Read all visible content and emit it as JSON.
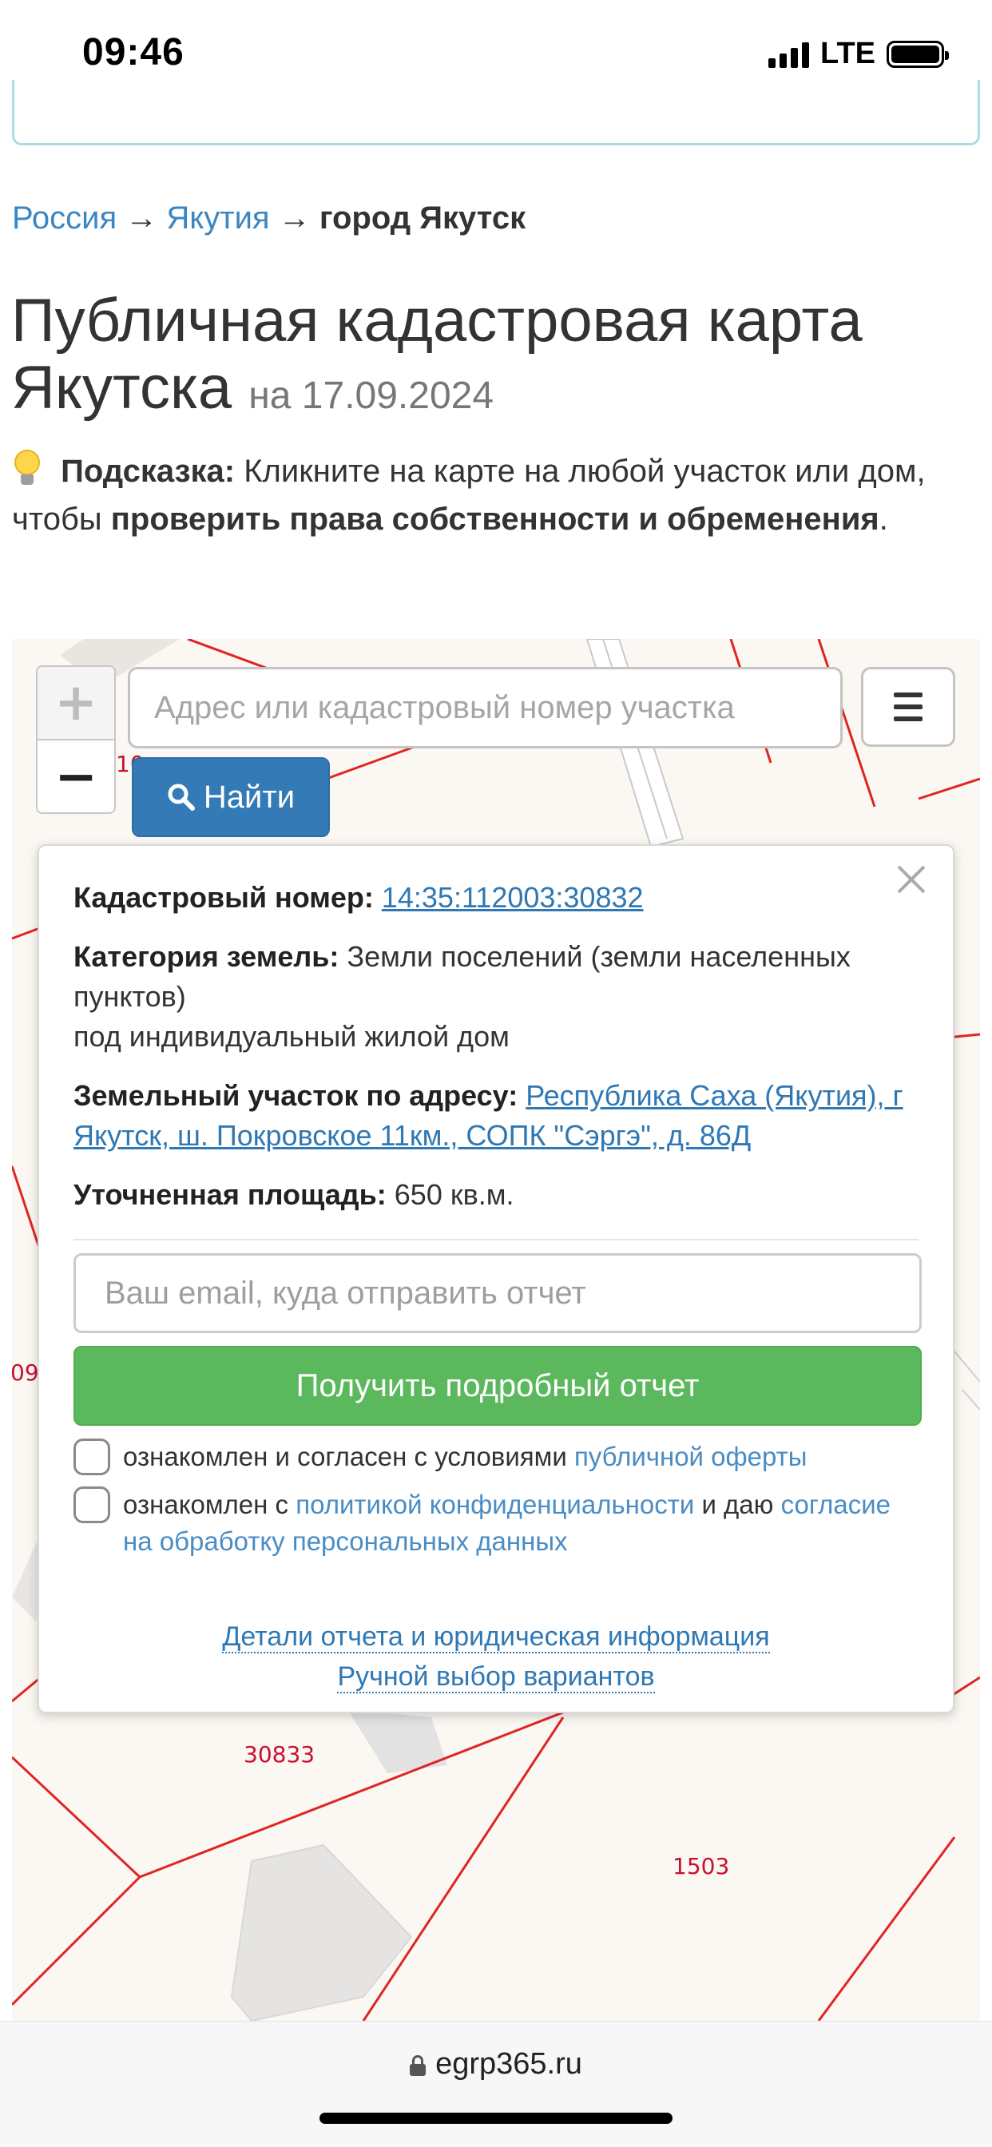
{
  "status_bar": {
    "time": "09:46",
    "network": "LTE"
  },
  "breadcrumb": {
    "country": "Россия",
    "region": "Якутия",
    "city": "город Якутск",
    "separator": "→"
  },
  "title": {
    "main": "Публичная кадастровая карта Якутска",
    "date": "на 17.09.2024"
  },
  "hint": {
    "icon": "lightbulb-icon",
    "label": "Подсказка:",
    "text1": "Кликните на карте на любой участок или дом, чтобы",
    "bold": "проверить права собственности и обременения",
    "end": "."
  },
  "map": {
    "zoom_in": "+",
    "zoom_out": "−",
    "search_placeholder": "Адрес или кадастровый номер участка",
    "find_label": "Найти",
    "parcel_labels": [
      "30833",
      "1503",
      "09",
      "10"
    ]
  },
  "popup": {
    "cadastral_label": "Кадастровый номер:",
    "cadastral_value": "14:35:112003:30832",
    "category_label": "Категория земель:",
    "category_value": "Земли поселений (земли населенных пунктов)",
    "usage": "под индивидуальный жилой дом",
    "address_label": "Земельный участок по адресу:",
    "address_value": "Республика Саха (Якутия), г Якутск, ш. Покровское 11км., СОПК \"Сэргэ\", д. 86Д",
    "area_label": "Уточненная площадь:",
    "area_value": "650 кв.м.",
    "email_placeholder": "Ваш email, куда отправить отчет",
    "report_button": "Получить подробный отчет",
    "consent1_text": "ознакомлен и согласен с условиями",
    "consent1_link": "публичной оферты",
    "consent2_text": "ознакомлен с",
    "consent2_link1": "политикой конфиденциальности",
    "consent2_mid": "и даю",
    "consent2_link2": "согласие на обработку персональных данных",
    "details_link": "Детали отчета и юридическая информация",
    "manual_link": "Ручной выбор вариантов"
  },
  "bottom_bar": {
    "url": "egrp365.ru"
  },
  "colors": {
    "link": "#3a86c2",
    "primary": "#337ab7",
    "success": "#5cb85c",
    "parcel_line": "#e02424"
  }
}
